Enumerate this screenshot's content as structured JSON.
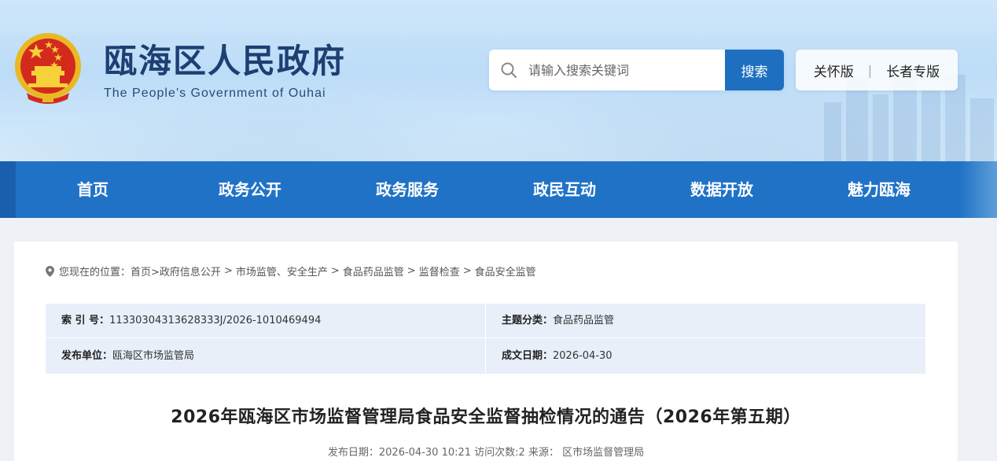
{
  "header": {
    "title": "瓯海区人民政府",
    "subtitle": "The People’s Government of Ouhai",
    "search": {
      "placeholder": "请输入搜索关键词",
      "button_label": "搜索"
    },
    "modes": {
      "care": "关怀版",
      "elder": "长者专版"
    }
  },
  "nav": {
    "items": [
      {
        "label": "首页"
      },
      {
        "label": "政务公开"
      },
      {
        "label": "政务服务"
      },
      {
        "label": "政民互动"
      },
      {
        "label": "数据开放"
      },
      {
        "label": "魅力瓯海"
      }
    ]
  },
  "breadcrumb": {
    "prefix": "您现在的位置：",
    "items": [
      "首页>",
      "政府信息公开",
      "市场监管、安全生产",
      "食品药品监管",
      "监督检查",
      "食品安全监管"
    ],
    "separator": ">"
  },
  "meta": {
    "index_label": "索 引 号：",
    "index_value": "11330304313628333J/2026-1010469494",
    "topic_label": "主题分类：",
    "topic_value": "食品药品监管",
    "publisher_label": "发布单位：",
    "publisher_value": "瓯海区市场监管局",
    "date_label": "成文日期：",
    "date_value": "2026-04-30"
  },
  "article": {
    "title": "2026年瓯海区市场监督管理局食品安全监督抽检情况的通告（2026年第五期）",
    "info": "发布日期：2026-04-30 10:21 访问次数:2 来源： 区市场监督管理局"
  },
  "colors": {
    "nav_bg": "#2072c6",
    "search_button": "#1f6fc0",
    "title_text": "#1d3f72"
  }
}
